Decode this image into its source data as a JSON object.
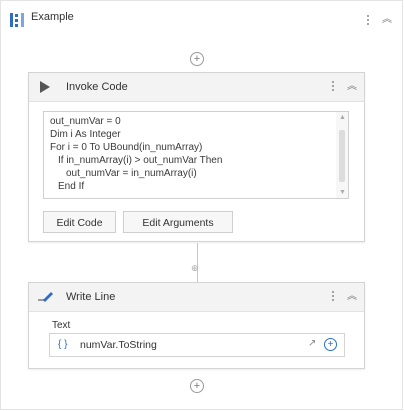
{
  "sequence": {
    "title": "Example"
  },
  "invoke_code": {
    "title": "Invoke Code",
    "code_lines": [
      "out_numVar = 0",
      "Dim i As Integer",
      "For i = 0 To UBound(in_numArray)",
      "If in_numArray(i) > out_numVar Then",
      "out_numVar = in_numArray(i)",
      "End If"
    ],
    "edit_code_label": "Edit Code",
    "edit_arguments_label": "Edit Arguments"
  },
  "write_line": {
    "title": "Write Line",
    "text_label": "Text",
    "text_value": "numVar.ToString"
  },
  "icons": {
    "sequence": "sequence-icon",
    "invoke_code": "play-icon",
    "write_line": "pencil-icon",
    "menu": "kebab-menu-icon",
    "collapse": "double-chevron-up-icon",
    "add": "plus-circle-icon",
    "expand_editor": "expand-icon",
    "variable": "braces-icon"
  },
  "colors": {
    "accent": "#2d6dc4",
    "play_icon": "#555555"
  }
}
